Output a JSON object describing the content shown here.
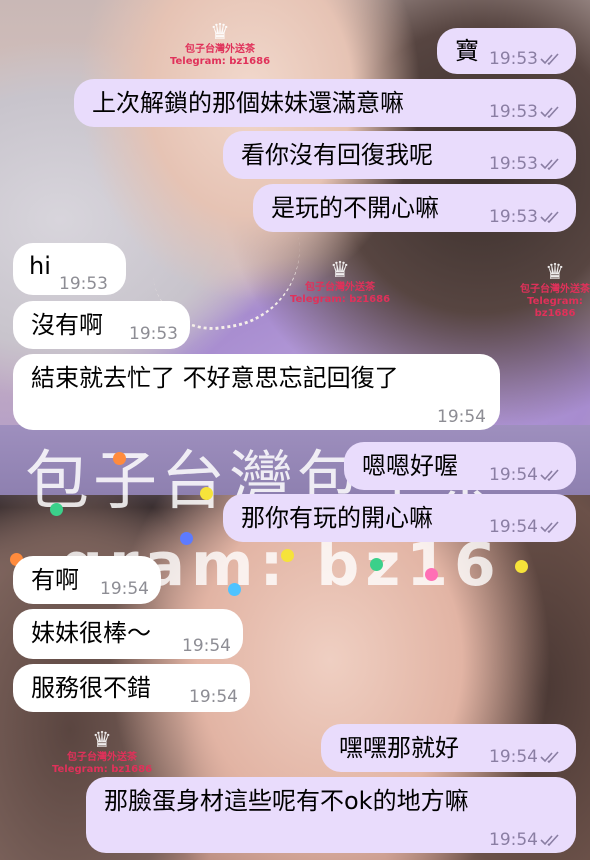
{
  "chat": {
    "messages": [
      {
        "dir": "out",
        "text": "寶",
        "time": "19:53",
        "read": true
      },
      {
        "dir": "out",
        "text": "上次解鎖的那個妹妹還滿意嘛",
        "time": "19:53",
        "read": true
      },
      {
        "dir": "out",
        "text": "看你沒有回復我呢",
        "time": "19:53",
        "read": true
      },
      {
        "dir": "out",
        "text": "是玩的不開心嘛",
        "time": "19:53",
        "read": true
      },
      {
        "dir": "in",
        "text": "hi",
        "time": "19:53"
      },
      {
        "dir": "in",
        "text": "沒有啊",
        "time": "19:53"
      },
      {
        "dir": "in",
        "text": "結束就去忙了 不好意思忘記回復了",
        "time": "19:54"
      },
      {
        "dir": "out",
        "text": "嗯嗯好喔",
        "time": "19:54",
        "read": true
      },
      {
        "dir": "out",
        "text": "那你有玩的開心嘛",
        "time": "19:54",
        "read": true
      },
      {
        "dir": "in",
        "text": "有啊",
        "time": "19:54"
      },
      {
        "dir": "in",
        "text": "妹妹很棒～",
        "time": "19:54"
      },
      {
        "dir": "in",
        "text": "服務很不錯",
        "time": "19:54"
      },
      {
        "dir": "out",
        "text": "嘿嘿那就好",
        "time": "19:54",
        "read": true
      },
      {
        "dir": "out",
        "text": "那臉蛋身材這些呢有不ok的地方嘛",
        "time": "19:54",
        "read": true
      }
    ]
  },
  "watermark": {
    "big_text": "包子台灣包子茶",
    "mid_text": "gram: bz16",
    "small_title": "包子台灣外送茶",
    "small_handle": "Telegram: bz1686",
    "crown_icon": "crown-icon"
  },
  "colors": {
    "outgoing_bubble": "#e9dcfc",
    "incoming_bubble": "#ffffff",
    "watermark_red": "#e0315a",
    "check_color": "#8a7ea3"
  }
}
